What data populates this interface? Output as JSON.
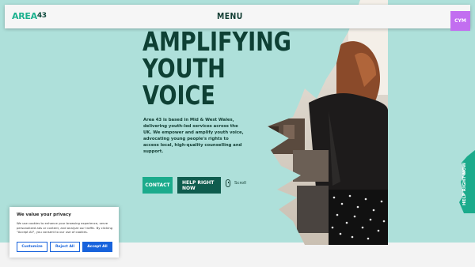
{
  "header": {
    "logo_text": "AREA",
    "logo_number": "43",
    "menu_label": "MENU",
    "lang_label": "CYM"
  },
  "hero": {
    "title_lines": [
      "AMPLIFYING",
      "YOUTH",
      "VOICE"
    ],
    "description": "Area 43 is based in Mid & West Wales, delivering youth-led services across the UK.  We empower and amplify youth voice, advocating young people's rights to access local, high-quality counselling and support.",
    "contact_label": "CONTACT",
    "help_label": "HELP RIGHT NOW",
    "scroll_label": "Scroll"
  },
  "side_tab": {
    "label": "HELP RIGHT NOW"
  },
  "cookie": {
    "title": "We value your privacy",
    "text": "We use cookies to enhance your browsing experience, serve personalized ads or content, and analyze our traffic. By clicking \"Accept All\", you consent to our use of cookies.",
    "customize_label": "Customize",
    "reject_label": "Reject All",
    "accept_label": "Accept All"
  },
  "colors": {
    "background": "#aee0da",
    "brand_green": "#1bab8c",
    "dark_green": "#0e4034",
    "lang_purple": "#c26ef0",
    "cookie_blue": "#1863dc"
  }
}
